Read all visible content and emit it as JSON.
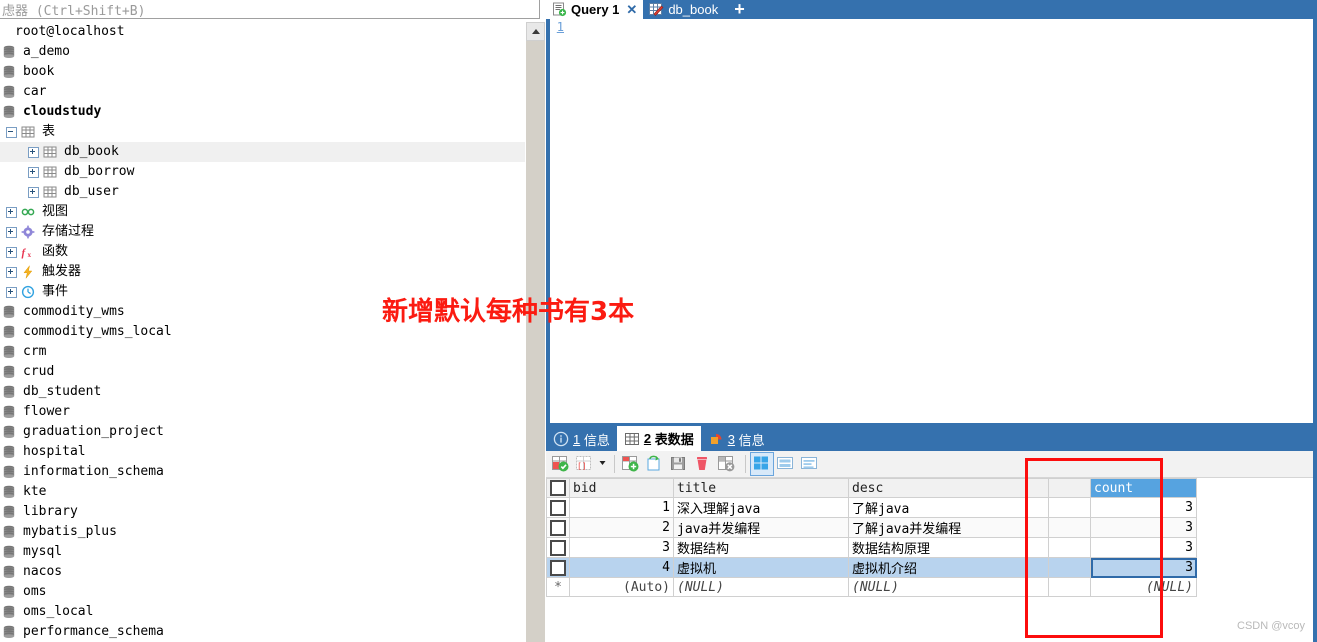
{
  "filter": {
    "placeholder": "虑器 (Ctrl+Shift+B)"
  },
  "tree": {
    "root": "root@localhost",
    "items": [
      {
        "label": "a_demo",
        "level": 1,
        "icon": "database-icon",
        "kind": "db"
      },
      {
        "label": "book",
        "level": 1,
        "icon": "database-icon",
        "kind": "db"
      },
      {
        "label": "car",
        "level": 1,
        "icon": "database-icon",
        "kind": "db"
      },
      {
        "label": "cloudstudy",
        "level": 1,
        "icon": "database-icon",
        "kind": "db",
        "bold": true
      },
      {
        "label": "表",
        "level": 2,
        "icon": "table-group-icon",
        "kind": "group",
        "expander": "minus"
      },
      {
        "label": "db_book",
        "level": 3,
        "icon": "table-icon",
        "kind": "table",
        "expander": "plus",
        "selected": true
      },
      {
        "label": "db_borrow",
        "level": 3,
        "icon": "table-icon",
        "kind": "table",
        "expander": "plus"
      },
      {
        "label": "db_user",
        "level": 3,
        "icon": "table-icon",
        "kind": "table",
        "expander": "plus"
      },
      {
        "label": "视图",
        "level": 2,
        "icon": "view-icon",
        "kind": "group",
        "expander": "plus"
      },
      {
        "label": "存储过程",
        "level": 2,
        "icon": "procedure-icon",
        "kind": "group",
        "expander": "plus"
      },
      {
        "label": "函数",
        "level": 2,
        "icon": "function-icon",
        "kind": "group",
        "expander": "plus"
      },
      {
        "label": "触发器",
        "level": 2,
        "icon": "trigger-icon",
        "kind": "group",
        "expander": "plus"
      },
      {
        "label": "事件",
        "level": 2,
        "icon": "event-icon",
        "kind": "group",
        "expander": "plus"
      },
      {
        "label": "commodity_wms",
        "level": 1,
        "icon": "database-icon",
        "kind": "db"
      },
      {
        "label": "commodity_wms_local",
        "level": 1,
        "icon": "database-icon",
        "kind": "db"
      },
      {
        "label": "crm",
        "level": 1,
        "icon": "database-icon",
        "kind": "db"
      },
      {
        "label": "crud",
        "level": 1,
        "icon": "database-icon",
        "kind": "db"
      },
      {
        "label": "db_student",
        "level": 1,
        "icon": "database-icon",
        "kind": "db"
      },
      {
        "label": "flower",
        "level": 1,
        "icon": "database-icon",
        "kind": "db"
      },
      {
        "label": "graduation_project",
        "level": 1,
        "icon": "database-icon",
        "kind": "db"
      },
      {
        "label": "hospital",
        "level": 1,
        "icon": "database-icon",
        "kind": "db"
      },
      {
        "label": "information_schema",
        "level": 1,
        "icon": "database-icon",
        "kind": "db"
      },
      {
        "label": "kte",
        "level": 1,
        "icon": "database-icon",
        "kind": "db"
      },
      {
        "label": "library",
        "level": 1,
        "icon": "database-icon",
        "kind": "db"
      },
      {
        "label": "mybatis_plus",
        "level": 1,
        "icon": "database-icon",
        "kind": "db"
      },
      {
        "label": "mysql",
        "level": 1,
        "icon": "database-icon",
        "kind": "db"
      },
      {
        "label": "nacos",
        "level": 1,
        "icon": "database-icon",
        "kind": "db"
      },
      {
        "label": "oms",
        "level": 1,
        "icon": "database-icon",
        "kind": "db"
      },
      {
        "label": "oms_local",
        "level": 1,
        "icon": "database-icon",
        "kind": "db"
      },
      {
        "label": "performance_schema",
        "level": 1,
        "icon": "database-icon",
        "kind": "db"
      }
    ]
  },
  "tabs": {
    "items": [
      {
        "label": "Query 1",
        "icon": "query-icon",
        "active": true,
        "closable": true
      },
      {
        "label": "db_book",
        "icon": "table-edit-icon",
        "active": false,
        "closable": false
      }
    ],
    "add_label": "+"
  },
  "editor": {
    "line_number": "1",
    "annotation": "新增默认每种书有3本",
    "annotation_color": "#fb1b11"
  },
  "result": {
    "tabs": [
      {
        "num": "1",
        "label": "信息",
        "icon": "info-icon",
        "active": false
      },
      {
        "num": "2",
        "label": "表数据",
        "icon": "grid-icon",
        "active": true
      },
      {
        "num": "3",
        "label": "信息",
        "icon": "chart-icon",
        "active": false
      }
    ],
    "toolbar": [
      {
        "name": "apply-changes-icon"
      },
      {
        "name": "filter-wizard-icon"
      },
      {
        "name": "add-record-icon"
      },
      {
        "name": "refresh-icon"
      },
      {
        "name": "save-icon"
      },
      {
        "name": "delete-record-icon"
      },
      {
        "name": "cancel-changes-icon"
      },
      {
        "name": "grid-view-icon"
      },
      {
        "name": "form-view-icon"
      },
      {
        "name": "text-view-icon"
      }
    ],
    "grid": {
      "columns": [
        "bid",
        "title",
        "desc",
        "",
        "count"
      ],
      "selected_column": "count",
      "rows": [
        {
          "bid": "1",
          "title": "深入理解java",
          "desc": "了解java",
          "gap": "",
          "count": "3"
        },
        {
          "bid": "2",
          "title": "java并发编程",
          "desc": "了解java并发编程",
          "gap": "",
          "count": "3"
        },
        {
          "bid": "3",
          "title": "数据结构",
          "desc": "数据结构原理",
          "gap": "",
          "count": "3"
        },
        {
          "bid": "4",
          "title": "虚拟机",
          "desc": "虚拟机介绍",
          "gap": "",
          "count": "3"
        }
      ],
      "new_row": {
        "marker": "*",
        "bid": "(Auto)",
        "title": "(NULL)",
        "desc": "(NULL)",
        "gap": "",
        "count": "(NULL)"
      }
    }
  },
  "watermark": "CSDN @vcoy",
  "colors": {
    "accent_blue": "#3571ae",
    "header_select_blue": "#56a3e0",
    "row_select_blue": "#b8d3ee",
    "annotation_red": "#fb1b11",
    "callout_red": "#fc0d0d"
  }
}
